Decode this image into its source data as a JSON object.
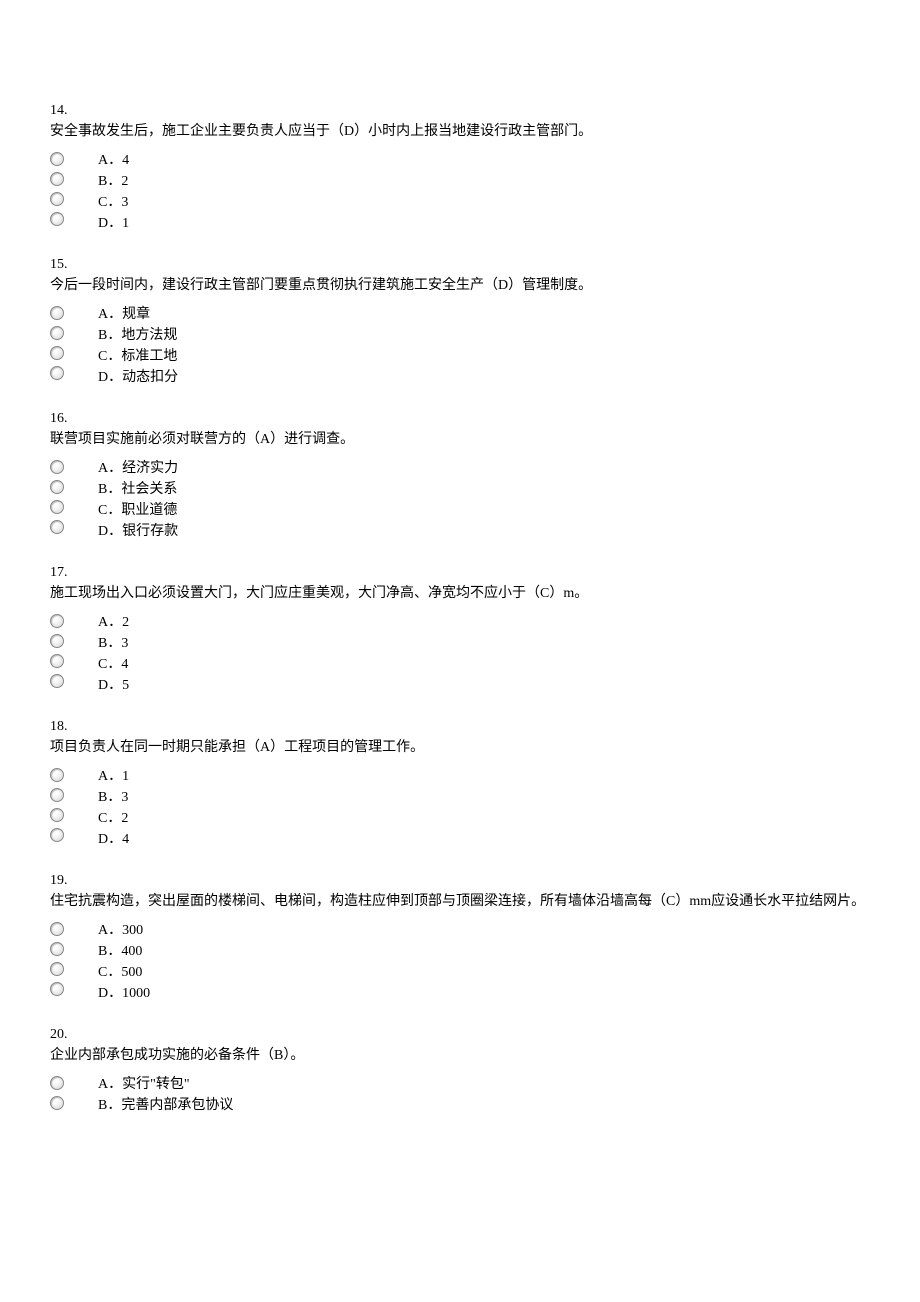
{
  "questions": [
    {
      "number": "14.",
      "stem": "安全事故发生后，施工企业主要负责人应当于（D）小时内上报当地建设行政主管部门。",
      "options": [
        "A．4",
        "B．2",
        "C．3",
        "D．1"
      ]
    },
    {
      "number": "15.",
      "stem": "今后一段时间内，建设行政主管部门要重点贯彻执行建筑施工安全生产（D）管理制度。",
      "options": [
        "A．规章",
        "B．地方法规",
        "C．标准工地",
        "D．动态扣分"
      ]
    },
    {
      "number": "16.",
      "stem": "联营项目实施前必须对联营方的（A）进行调查。",
      "options": [
        "A．经济实力",
        "B．社会关系",
        "C．职业道德",
        "D．银行存款"
      ]
    },
    {
      "number": "17.",
      "stem": "施工现场出入口必须设置大门，大门应庄重美观，大门净高、净宽均不应小于（C）m。",
      "options": [
        "A．2",
        "B．3",
        "C．4",
        "D．5"
      ]
    },
    {
      "number": "18.",
      "stem": "项目负责人在同一时期只能承担（A）工程项目的管理工作。",
      "options": [
        "A．1",
        "B．3",
        "C．2",
        "D．4"
      ]
    },
    {
      "number": "19.",
      "stem": "住宅抗震构造，突出屋面的楼梯间、电梯间，构造柱应伸到顶部与顶圈梁连接，所有墙体沿墙高每（C）mm应设通长水平拉结网片。",
      "options": [
        "A．300",
        "B．400",
        "C．500",
        "D．1000"
      ]
    },
    {
      "number": "20.",
      "stem": "企业内部承包成功实施的必备条件（B）。",
      "options": [
        "A．实行\"转包\"",
        "B．完善内部承包协议"
      ]
    }
  ]
}
